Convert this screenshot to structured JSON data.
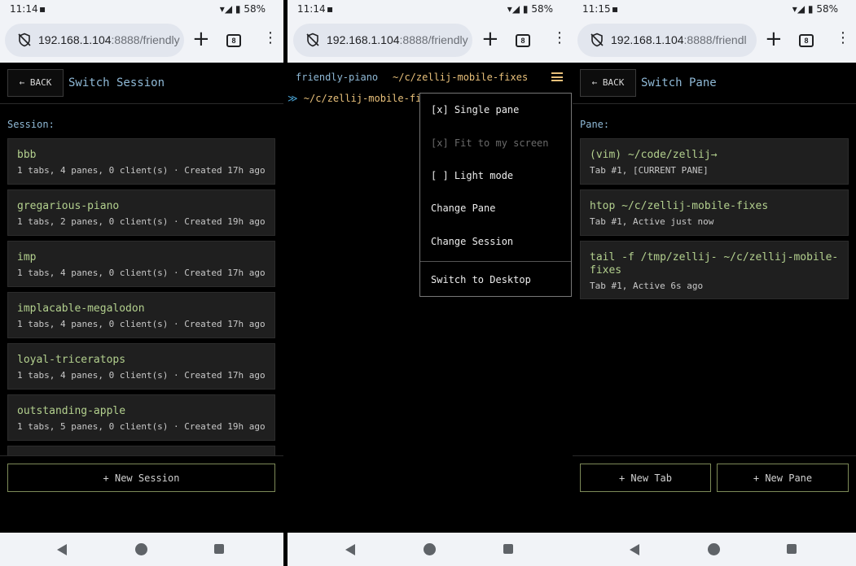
{
  "phones": [
    {
      "status": {
        "time": "11:14",
        "battery": "58%"
      },
      "browser": {
        "url_host": "192.168.1.104",
        "url_rest": ":8888/friendly",
        "tab_count": "8"
      },
      "header": {
        "back": "← BACK",
        "title": "Switch Session"
      },
      "section_label": "Session:",
      "sessions": [
        {
          "name": "bbb",
          "meta": "1 tabs, 4 panes, 0 client(s) · Created 17h ago"
        },
        {
          "name": "gregarious-piano",
          "meta": "1 tabs, 2 panes, 0 client(s) · Created 19h ago"
        },
        {
          "name": "imp",
          "meta": "1 tabs, 4 panes, 0 client(s) · Created 17h ago"
        },
        {
          "name": "implacable-megalodon",
          "meta": "1 tabs, 4 panes, 0 client(s) · Created 17h ago"
        },
        {
          "name": "loyal-triceratops",
          "meta": "1 tabs, 4 panes, 0 client(s) · Created 17h ago"
        },
        {
          "name": "outstanding-apple",
          "meta": "1 tabs, 5 panes, 0 client(s) · Created 19h ago"
        }
      ],
      "new_button": "+ New Session"
    },
    {
      "status": {
        "time": "11:14",
        "battery": "58%"
      },
      "browser": {
        "url_host": "192.168.1.104",
        "url_rest": ":8888/friendly",
        "tab_count": "8"
      },
      "terminal": {
        "session_tab": "friendly-piano",
        "path_tab": "~/c/zellij-mobile-fixes",
        "prompt_symbol": "≫",
        "prompt_path": "~/c/zellij-mobile-fix"
      },
      "menu": [
        {
          "label": "[x] Single pane",
          "enabled": true
        },
        {
          "label": "[x] Fit to my screen",
          "enabled": false
        },
        {
          "label": "[ ] Light mode",
          "enabled": true
        },
        {
          "label": "Change Pane",
          "enabled": true
        },
        {
          "label": "Change Session",
          "enabled": true
        },
        {
          "label": "Switch to Desktop",
          "enabled": true
        }
      ]
    },
    {
      "status": {
        "time": "11:15",
        "battery": "58%"
      },
      "browser": {
        "url_host": "192.168.1.104",
        "url_rest": ":8888/friendl",
        "tab_count": "8"
      },
      "header": {
        "back": "← BACK",
        "title": "Switch Pane"
      },
      "section_label": "Pane:",
      "panes": [
        {
          "name": "(vim) ~/code/zellij→",
          "meta": "Tab #1, [CURRENT PANE]"
        },
        {
          "name": "htop ~/c/zellij-mobile-fixes",
          "meta": "Tab #1, Active just now"
        },
        {
          "name": "tail -f /tmp/zellij- ~/c/zellij-mobile-fixes",
          "meta": "Tab #1, Active 6s ago"
        }
      ],
      "new_tab_button": "+ New Tab",
      "new_pane_button": "+ New Pane"
    }
  ],
  "colors": {
    "accent_blue": "#8fb9d6",
    "accent_green": "#b3d08e",
    "accent_yellow": "#e8c07a",
    "border_green": "#7d8a58"
  }
}
